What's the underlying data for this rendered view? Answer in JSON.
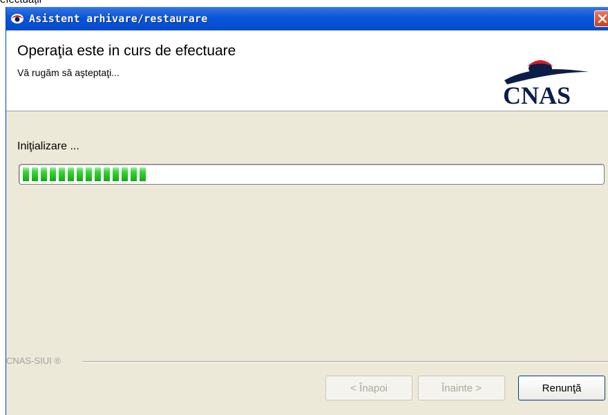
{
  "background": {
    "caption": "efectuații"
  },
  "window": {
    "title": "Asistent arhivare/restaurare",
    "icons": {
      "app": "eye-icon",
      "close": "close-icon"
    }
  },
  "header": {
    "title": "Operaţia este in curs de efectuare",
    "subtitle": "Vă rugăm să aşteptaţi...",
    "logo_text": "CNAS"
  },
  "status": {
    "label": "Iniţializare ...",
    "progress_percent": 22,
    "progress_blocks": 14
  },
  "footer": {
    "brand": "CNAS-SIUI ®",
    "buttons": {
      "back": "< Înapoi",
      "next": "Înainte >",
      "cancel": "Renunţă"
    }
  },
  "colors": {
    "titlebar": "#0a56d8",
    "progress": "#23c623",
    "logo_red": "#d21f2b",
    "logo_navy": "#0d1d4a"
  }
}
